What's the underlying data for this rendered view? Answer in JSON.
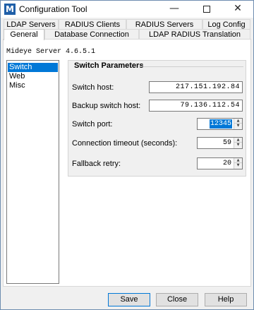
{
  "window": {
    "icon_letter": "M",
    "title": "Configuration Tool",
    "minimize": "—",
    "close": "✕"
  },
  "tabs": {
    "row1": [
      "LDAP Servers",
      "RADIUS Clients",
      "RADIUS Servers",
      "Log Config"
    ],
    "row2": [
      "General",
      "Database Connection",
      "LDAP RADIUS Translation"
    ],
    "active": "General"
  },
  "server_version": "Mideye Server 4.6.5.1",
  "left_list": {
    "items": [
      "Switch",
      "Web",
      "Misc"
    ],
    "selected": "Switch"
  },
  "switch_parameters": {
    "title": "Switch Parameters",
    "switch_host": {
      "label": "Switch host:",
      "value": "217.151.192.84"
    },
    "backup_switch_host": {
      "label": "Backup switch host:",
      "value": "79.136.112.54"
    },
    "switch_port": {
      "label": "Switch port:",
      "value": "12345"
    },
    "connection_timeout": {
      "label": "Connection timeout (seconds):",
      "value": "59"
    },
    "fallback_retry": {
      "label": "Fallback retry:",
      "value": "20"
    }
  },
  "buttons": {
    "save": "Save",
    "close": "Close",
    "help": "Help"
  }
}
